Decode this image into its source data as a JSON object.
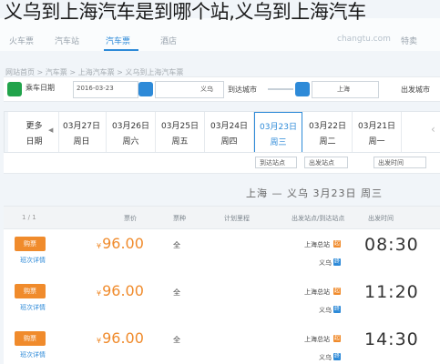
{
  "headline": "义乌到上海汽车是到哪个站,义乌到上海汽车",
  "nav": {
    "tabs": [
      "火车票",
      "汽车站",
      "汽车票",
      "酒店",
      "特卖"
    ],
    "active_index": 2,
    "watermark": "changtu.com"
  },
  "breadcrumb": "网站首页 > 汽车票 > 上海汽车票 > 义乌到上海汽车票",
  "search": {
    "from_label": "出发城市",
    "from_value": "义乌",
    "to_label": "到达城市",
    "to_value": "上海",
    "date_label": "乘车日期",
    "date_value": "2016-03-23",
    "date_weekday": "周三",
    "search_label": "搜索"
  },
  "dates": [
    {
      "day": "更多",
      "week": "日期"
    },
    {
      "day": "03月27日",
      "week": "周日"
    },
    {
      "day": "03月26日",
      "week": "周六"
    },
    {
      "day": "03月25日",
      "week": "周五"
    },
    {
      "day": "03月24日",
      "week": "周四"
    },
    {
      "day": "03月23日",
      "week": "周三"
    },
    {
      "day": "03月22日",
      "week": "周二"
    },
    {
      "day": "03月21日",
      "week": "周一"
    }
  ],
  "active_date_index": 5,
  "filters": {
    "arrive_station": "到达站点",
    "depart_station": "出发站点",
    "depart_time": "出发时间"
  },
  "route_line": "上海 — 义乌  3月23日  周三",
  "columns": {
    "page": "1 / 1",
    "price": "票价",
    "type": "票种",
    "duration": "计划里程",
    "stations": "出发站点/到达站点",
    "time": "出发时间"
  },
  "rows": [
    {
      "time": "08:30",
      "price": "96.00",
      "currency": "¥",
      "type": "全",
      "from": "上海总站",
      "to": "义乌",
      "buy": "购票",
      "more": "班次详情"
    },
    {
      "time": "11:20",
      "price": "96.00",
      "currency": "¥",
      "type": "全",
      "from": "上海总站",
      "to": "义乌",
      "buy": "购票",
      "more": "班次详情"
    },
    {
      "time": "14:30",
      "price": "96.00",
      "currency": "¥",
      "type": "全",
      "from": "上海总站",
      "to": "义乌",
      "buy": "购票",
      "more": "班次详情"
    }
  ],
  "colors": {
    "accent": "#2d8ad8",
    "price": "#f08b2c",
    "green": "#21a34b"
  }
}
